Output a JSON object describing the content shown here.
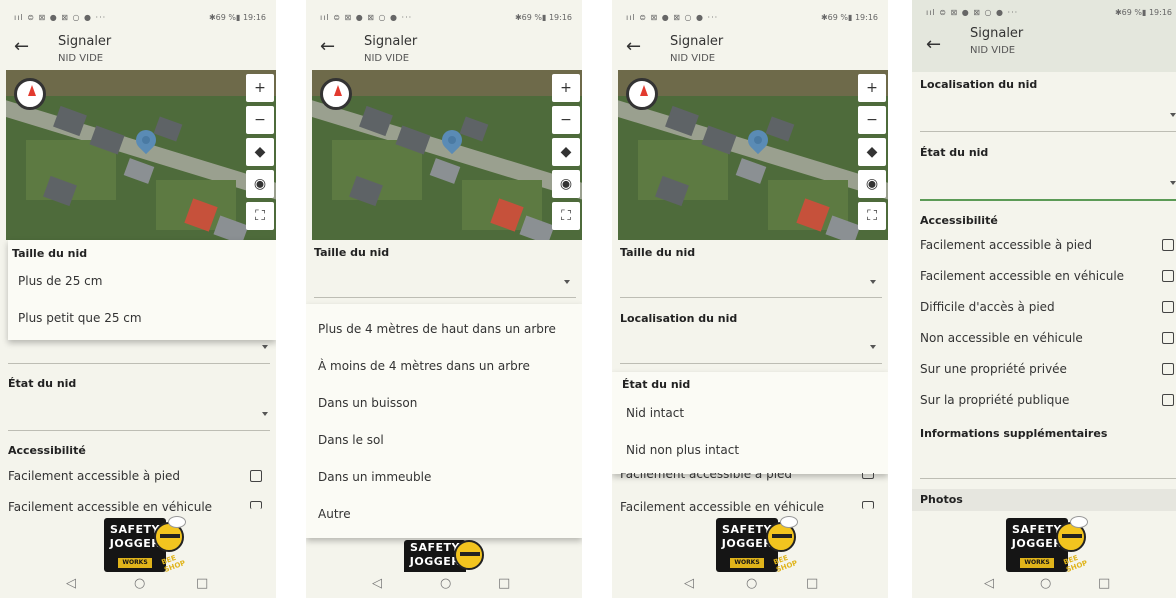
{
  "status": {
    "left": "ııl ⊜ ⊠ ● ⊠ ○ ● ···",
    "right": "✱69 %▮ 19:16"
  },
  "header": {
    "back_icon": "arrow-left-icon",
    "title": "Signaler",
    "subtitle": "NID VIDE"
  },
  "map": {
    "zoom_in": "+",
    "zoom_out": "−",
    "layers_icon": "layers-icon",
    "locate_icon": "crosshair-icon",
    "fullscreen_icon": "fullscreen-icon",
    "layers_glyph": "◆",
    "locate_glyph": "◉",
    "fullscreen_glyph": "⛶"
  },
  "labels": {
    "taille": "Taille du nid",
    "localisation": "Localisation du nid",
    "etat": "État du nid",
    "accessibilite": "Accessibilité",
    "infos": "Informations supplémentaires",
    "photos": "Photos"
  },
  "accessibility_options": [
    "Facilement accessible à pied",
    "Facilement accessible en véhicule",
    "Difficile d'accès à pied",
    "Non accessible en véhicule",
    "Sur une propriété privée",
    "Sur la propriété publique"
  ],
  "size_options": [
    "Plus de 25 cm",
    "Plus petit que 25 cm"
  ],
  "location_options": [
    "Plus de 4 mètres de haut dans un arbre",
    "À moins de 4 mètres dans un arbre",
    "Dans un buisson",
    "Dans le sol",
    "Dans un immeuble",
    "Autre"
  ],
  "state_options": [
    "Nid intact",
    "Nid non plus intact"
  ],
  "logo": {
    "line1": "SAFETY",
    "line2": "JOGGER",
    "works": "WORKS",
    "bee_shop": "BEE SHOP"
  },
  "nav": {
    "back": "◁",
    "home": "○",
    "recent": "□"
  }
}
